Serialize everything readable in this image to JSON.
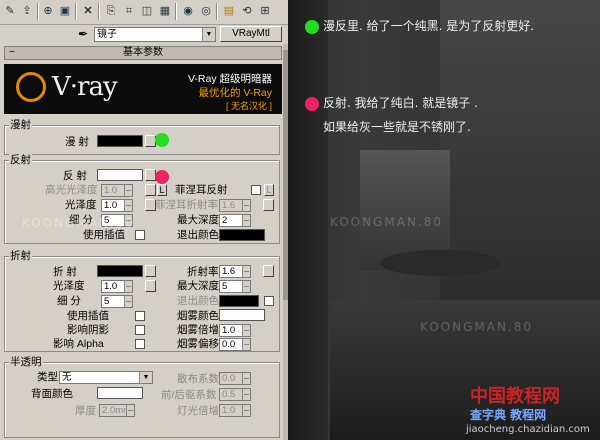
{
  "toolbar": {
    "icons": [
      "pick-material-icon",
      "put-to-scene-icon",
      "assign-icon",
      "reset-icon",
      "copy-icon",
      "unique-icon",
      "put-library-icon",
      "material-id-icon",
      "show-map-icon",
      "show-end-icon",
      "go-parent-icon",
      "go-sibling-icon"
    ]
  },
  "material": {
    "name": "镜子",
    "type_button": "VRayMtl"
  },
  "rollout": {
    "title": "基本参数"
  },
  "banner": {
    "logo": "V·ray",
    "line1": "V-Ray 超级明暗器",
    "line2": "最优化的 V-Ray",
    "line3": "[ 无名汉化 ]"
  },
  "diffuse": {
    "group_title": "漫射",
    "label": "漫 射",
    "color": "#000000"
  },
  "reflection": {
    "group_title": "反射",
    "label": "反 射",
    "color": "#ffffff",
    "hilight_gloss_label": "高光光泽度",
    "hilight_gloss_value": "1.0",
    "lock_label": "L",
    "gloss_label": "光泽度",
    "gloss_value": "1.0",
    "subdivs_label": "细 分",
    "subdivs_value": "5",
    "interp_label": "使用插值",
    "fresnel_label": "菲涅耳反射",
    "fresnel_lock": "L",
    "fresnel_ior_label": "菲涅耳折射率",
    "fresnel_ior_value": "1.6",
    "max_depth_label": "最大深度",
    "max_depth_value": "2",
    "exit_color_label": "退出颜色",
    "exit_color": "#000000"
  },
  "refraction": {
    "group_title": "折射",
    "label": "折 射",
    "color": "#000000",
    "gloss_label": "光泽度",
    "gloss_value": "1.0",
    "subdivs_label": "细 分",
    "subdivs_value": "5",
    "interp_label": "使用插值",
    "shadows_label": "影响阴影",
    "alpha_label": "影响 Alpha",
    "ior_label": "折射率",
    "ior_value": "1.6",
    "max_depth_label": "最大深度",
    "max_depth_value": "5",
    "exit_color_label": "退出颜色",
    "fog_color_label": "烟雾颜色",
    "fog_mult_label": "烟雾倍增",
    "fog_mult_value": "1.0",
    "fog_bias_label": "烟雾偏移",
    "fog_bias_value": "0.0"
  },
  "translucency": {
    "group_title": "半透明",
    "type_label": "类型",
    "type_value": "无",
    "back_color_label": "背面颜色",
    "thickness_label": "厚度",
    "thickness_value": "2.0mm",
    "scatter_label": "散布系数",
    "scatter_value": "0.0",
    "fwd_back_label": "前/后驱系数",
    "fwd_back_value": "0.5",
    "light_mult_label": "灯光倍增",
    "light_mult_value": "1.0"
  },
  "annotations": {
    "green_color": "#22dd22",
    "pink_color": "#ee2266",
    "note1": "漫反里. 给了一个纯黑. 是为了反射更好.",
    "note2": "反射. 我给了纯白. 就是镜子 .",
    "note3": "如果给灰一些就是不锈刚了."
  },
  "watermarks": {
    "bg1": "KOONGMAN.80",
    "bg2": "KOONGMAN.80",
    "bg3": "KOONGMAN.80",
    "site_cn": "中国教程网",
    "site_cn2": "查字典 教程网",
    "site_url": "jiaocheng.chazidian.com"
  }
}
